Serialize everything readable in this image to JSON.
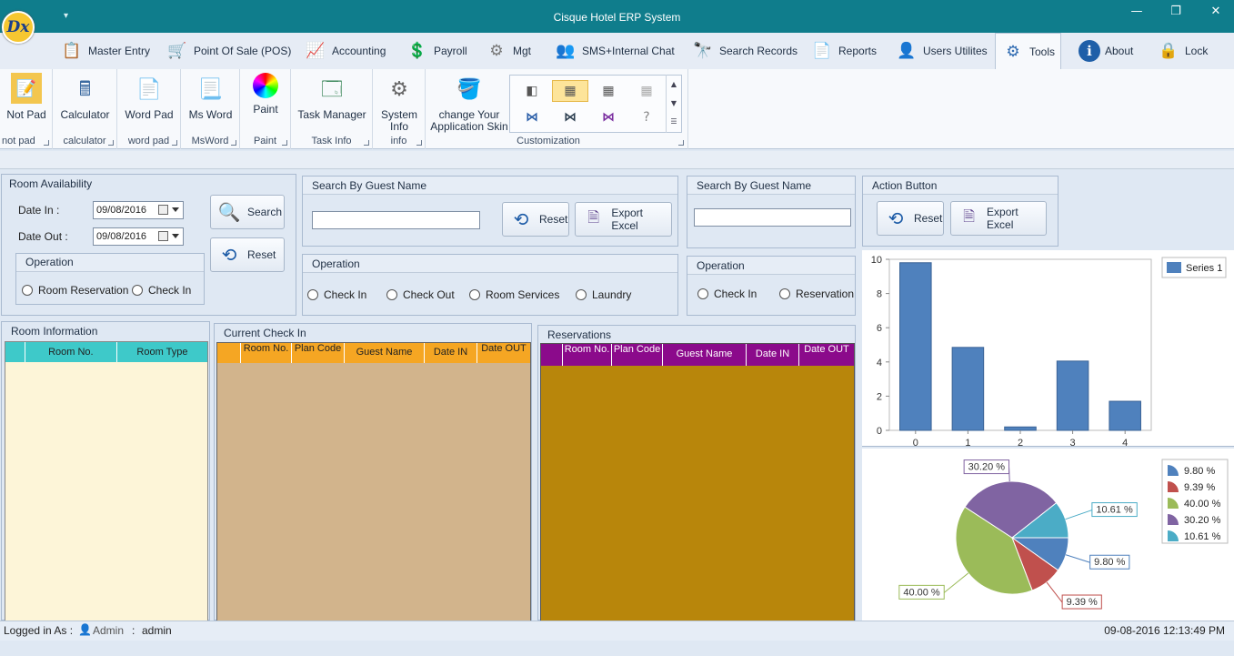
{
  "window": {
    "title": "Cisque Hotel ERP System",
    "logo_text": "Dx",
    "qat_glyph": "▾",
    "min": "—",
    "restore": "❐",
    "close": "✕"
  },
  "tabs": [
    {
      "label": "Master Entry",
      "icon": "master-entry-icon",
      "glyph": "📋",
      "color": "#e0a21c"
    },
    {
      "label": "Point Of Sale (POS)",
      "icon": "cart-icon",
      "glyph": "🛒",
      "color": "#c0392b"
    },
    {
      "label": "Accounting",
      "icon": "chart-icon",
      "glyph": "📈",
      "color": "#d68910"
    },
    {
      "label": "Payroll",
      "icon": "coins-icon",
      "glyph": "💲",
      "color": "#b7950b"
    },
    {
      "label": "Mgt",
      "icon": "management-icon",
      "glyph": "⚙",
      "color": "#777"
    },
    {
      "label": "SMS+Internal Chat",
      "icon": "users-chat-icon",
      "glyph": "👥",
      "color": "#2e6ab1"
    },
    {
      "label": "Search Records",
      "icon": "binoculars-icon",
      "glyph": "🔭",
      "color": "#2c3e66"
    },
    {
      "label": "Reports",
      "icon": "clipboard-icon",
      "glyph": "📄",
      "color": "#c9892a"
    },
    {
      "label": "Users Utilites",
      "icon": "user-gear-icon",
      "glyph": "👤",
      "color": "#555"
    },
    {
      "label": "Tools",
      "icon": "gears-icon",
      "glyph": "⚙",
      "color": "#2e6ab1"
    },
    {
      "label": "About",
      "icon": "info-icon",
      "glyph": "ℹ",
      "color": "#1f5fa8"
    },
    {
      "label": "Lock",
      "icon": "lock-icon",
      "glyph": "🔒",
      "color": "#444"
    }
  ],
  "ribbon": {
    "groups": [
      {
        "label": "not pad",
        "buttons": [
          {
            "label": "Not Pad",
            "icon": "notepad-icon",
            "glyph": "📝"
          }
        ]
      },
      {
        "label": "calculator",
        "buttons": [
          {
            "label": "Calculator",
            "icon": "calculator-icon",
            "glyph": "🖩"
          }
        ]
      },
      {
        "label": "word pad",
        "buttons": [
          {
            "label": "Word Pad",
            "icon": "wordpad-icon",
            "glyph": "📄"
          }
        ]
      },
      {
        "label": "MsWord",
        "buttons": [
          {
            "label": "Ms Word",
            "icon": "msword-icon",
            "glyph": "📃"
          }
        ]
      },
      {
        "label": "Paint",
        "buttons": [
          {
            "label": "Paint",
            "icon": "paint-palette-icon",
            "glyph": "🎨"
          }
        ]
      },
      {
        "label": "Task  Info",
        "buttons": [
          {
            "label": "Task Manager",
            "icon": "task-manager-icon",
            "glyph": "🗔"
          }
        ]
      },
      {
        "label": "info",
        "buttons": [
          {
            "label": "System Info",
            "icon": "system-info-icon",
            "glyph": "⚙"
          }
        ]
      },
      {
        "label": "Customization",
        "buttons": [
          {
            "label": "change Your Application Skin",
            "icon": "paint-bucket-icon",
            "glyph": "🪣"
          }
        ]
      }
    ],
    "skins_row1": [
      "◧",
      "▦",
      "▦",
      "▦"
    ],
    "skins_row2": [
      "⋈",
      "⋈",
      "⋈",
      "?"
    ],
    "scroll_up": "▲",
    "scroll_down": "▼",
    "scroll_more": "☰"
  },
  "room_availability": {
    "title": "Room Availability",
    "date_in_label": "Date In :",
    "date_in": "09/08/2016",
    "date_out_label": "Date Out :",
    "date_out": "09/08/2016",
    "search": "Search",
    "reset": "Reset",
    "operation": "Operation",
    "radio1": "Room Reservation",
    "radio2": "Check In"
  },
  "search_guest1": {
    "title": "Search By Guest Name",
    "reset": "Reset",
    "export": "Export Excel",
    "operation": "Operation",
    "radios": [
      "Check In",
      "Check Out",
      "Room Services",
      "Laundry"
    ]
  },
  "search_guest2": {
    "title": "Search By Guest Name",
    "operation": "Operation",
    "radios": [
      "Check In",
      "Reservation"
    ]
  },
  "action": {
    "title": "Action Button",
    "reset": "Reset",
    "export": "Export Excel"
  },
  "room_info": {
    "title": "Room Information",
    "cols": [
      "",
      "Room No.",
      "Room Type"
    ],
    "header_color": "#3ec9c9",
    "body_color": "#fdf5d8"
  },
  "current_checkin": {
    "title": "Current Check In",
    "cols": [
      "",
      "Room No.",
      "Plan Code",
      "Guest Name",
      "Date IN",
      "Date OUT"
    ],
    "header_color": "#f5a623",
    "body_color": "#d2b48c"
  },
  "reservations": {
    "title": "Reservations",
    "cols": [
      "",
      "Room No.",
      "Plan Code",
      "Guest Name",
      "Date IN",
      "Date OUT"
    ],
    "header_color": "#8b0a8b",
    "body_color": "#b8860b"
  },
  "chart_data": [
    {
      "type": "bar",
      "categories": [
        "0",
        "1",
        "2",
        "3",
        "4"
      ],
      "series": [
        {
          "name": "Series 1",
          "values": [
            9.8,
            4.85,
            0.2,
            4.05,
            1.7
          ]
        }
      ],
      "ylim": [
        0,
        10
      ],
      "yticks": [
        "0",
        "2",
        "4",
        "6",
        "8",
        "10"
      ],
      "color": "#4f81bd",
      "legend": "top-right",
      "grid": false
    },
    {
      "type": "pie",
      "slices": [
        {
          "label": "9.80 %",
          "value": 9.8,
          "color": "#4f81bd"
        },
        {
          "label": "9.39 %",
          "value": 9.39,
          "color": "#c0504d"
        },
        {
          "label": "40.00 %",
          "value": 40.0,
          "color": "#9bbb59"
        },
        {
          "label": "30.20 %",
          "value": 30.2,
          "color": "#8064a2"
        },
        {
          "label": "10.61 %",
          "value": 10.61,
          "color": "#4bacc6"
        }
      ],
      "legend": "right"
    }
  ],
  "status": {
    "logged_label": "Logged in As :",
    "user_icon": "user-icon",
    "role": "Admin",
    "sep": ":",
    "user": "admin",
    "datetime": "09-08-2016 12:13:49 PM"
  }
}
